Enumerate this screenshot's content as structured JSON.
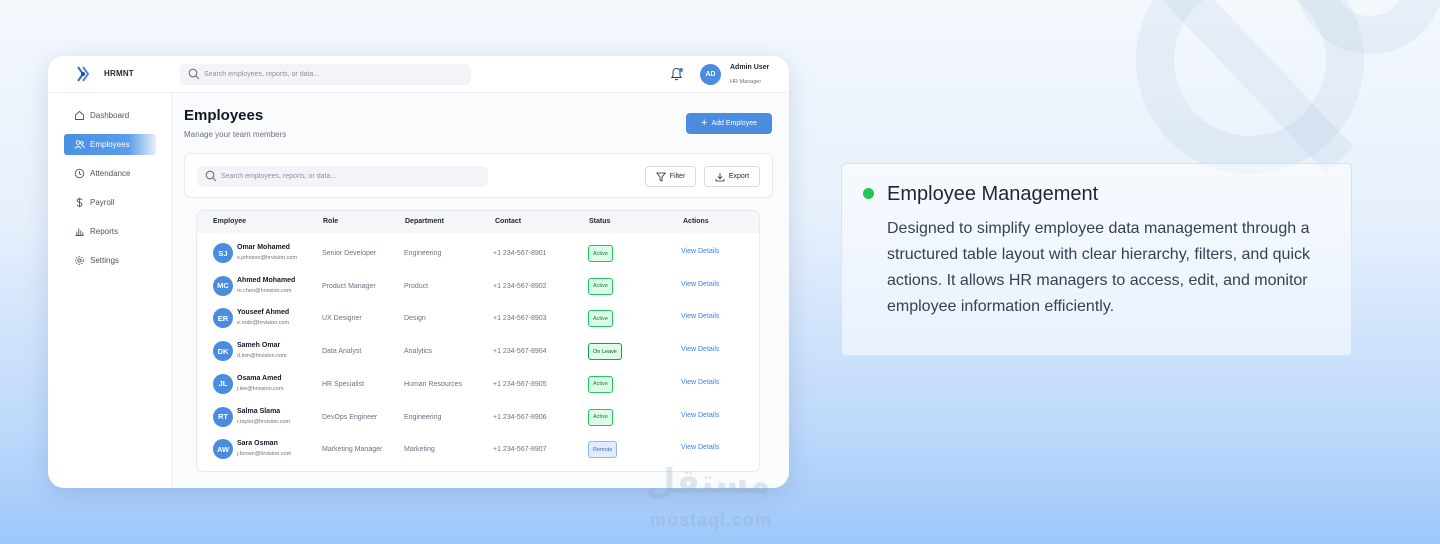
{
  "app": {
    "brand": "HRMNT",
    "search_placeholder": "Search employees, reports, or data...",
    "user": {
      "initials": "AD",
      "name": "Admin User",
      "role": "HR Manager"
    }
  },
  "sidebar": {
    "items": [
      {
        "label": "Dashboard",
        "icon": "home-icon",
        "active": false
      },
      {
        "label": "Employees",
        "icon": "users-icon",
        "active": true
      },
      {
        "label": "Attendance",
        "icon": "clock-icon",
        "active": false
      },
      {
        "label": "Payroll",
        "icon": "dollar-icon",
        "active": false
      },
      {
        "label": "Reports",
        "icon": "bar-chart-icon",
        "active": false
      },
      {
        "label": "Settings",
        "icon": "gear-icon",
        "active": false
      }
    ]
  },
  "main": {
    "title": "Employees",
    "subtitle": "Manage your team members",
    "add_button": "Add Employee",
    "filter_search_placeholder": "Search employees, reports, or data...",
    "filter_button": "Filter",
    "export_button": "Export"
  },
  "table": {
    "headers": [
      "Employee",
      "Role",
      "Department",
      "Contact",
      "Status",
      "Actions"
    ],
    "rows": [
      {
        "initials": "SJ",
        "name": "Omar Mohamed",
        "email": "s.johnson@hrvision.com",
        "role": "Senior Developer",
        "department": "Engineering",
        "contact": "+1 234-567-8901",
        "status": "Active",
        "status_type": "active",
        "action": "View Details"
      },
      {
        "initials": "MC",
        "name": "Ahmed Mohamed",
        "email": "m.chen@hrvision.com",
        "role": "Product Manager",
        "department": "Product",
        "contact": "+1 234-567-8902",
        "status": "Active",
        "status_type": "active",
        "action": "View Details"
      },
      {
        "initials": "ER",
        "name": "Youseef Ahmed",
        "email": "e.rodri@hrvision.com",
        "role": "UX Designer",
        "department": "Design",
        "contact": "+1 234-567-8903",
        "status": "Active",
        "status_type": "active",
        "action": "View Details"
      },
      {
        "initials": "DK",
        "name": "Sameh Omar",
        "email": "d.kim@hrvision.com",
        "role": "Data Analyst",
        "department": "Analytics",
        "contact": "+1 234-567-8904",
        "status": "On Leave",
        "status_type": "leave",
        "action": "View Details"
      },
      {
        "initials": "JL",
        "name": "Osama Amed",
        "email": "j.lee@hrvision.com",
        "role": "HR Specialist",
        "department": "Human Resources",
        "contact": "+1 234-567-8905",
        "status": "Active",
        "status_type": "active",
        "action": "View Details"
      },
      {
        "initials": "RT",
        "name": "Salma Slama",
        "email": "r.taylor@hrvision.com",
        "role": "DevOps Engineer",
        "department": "Engineering",
        "contact": "+1 234-567-8906",
        "status": "Active",
        "status_type": "active",
        "action": "View Details"
      },
      {
        "initials": "AW",
        "name": "Sara Osman",
        "email": "j.brown@hrvision.com",
        "role": "Marketing Manager",
        "department": "Marketing",
        "contact": "+1 234-567-8907",
        "status": "Remote",
        "status_type": "remote",
        "action": "View Details"
      }
    ]
  },
  "feature": {
    "title": "Employee Management",
    "description": "Designed to simplify employee data management through a structured table layout with clear hierarchy, filters, and quick actions. It allows HR managers to access, edit, and monitor employee information efficiently."
  },
  "watermark": {
    "arabic": "مستقل",
    "latin": "mostaql.com"
  },
  "colors": {
    "accent": "#4a8de0",
    "success": "#22c55e",
    "link": "#3b82f6"
  }
}
